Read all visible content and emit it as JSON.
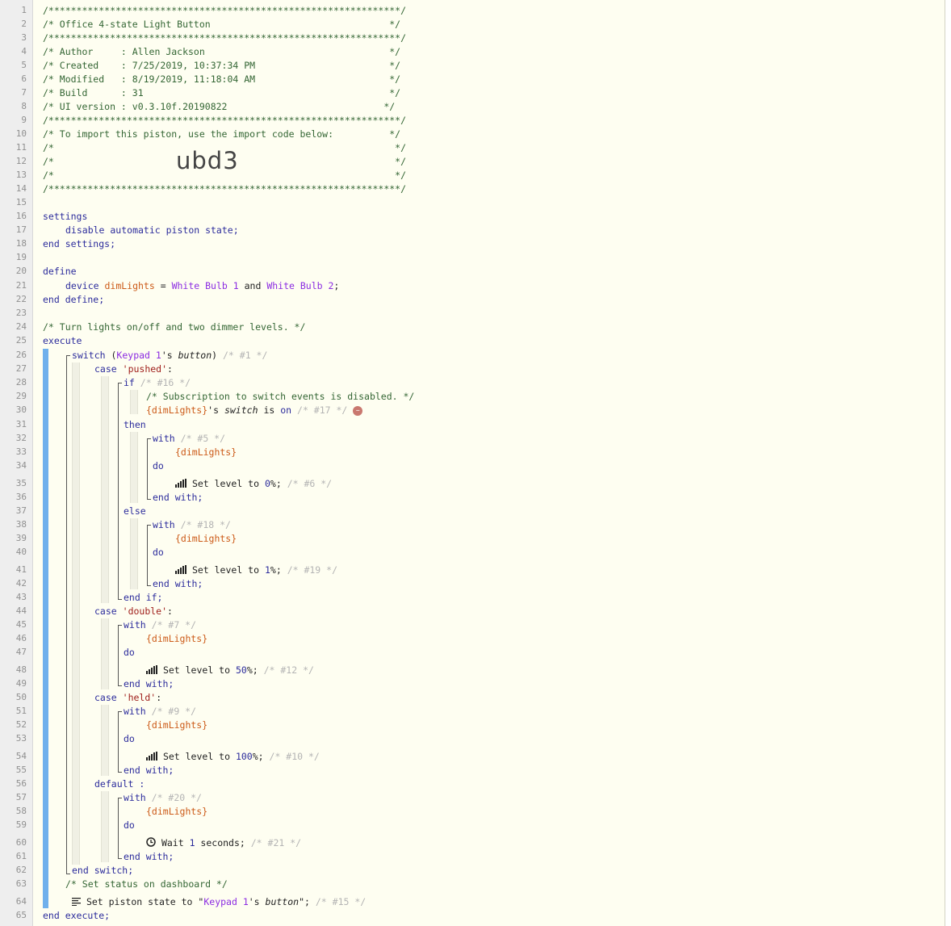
{
  "header": {
    "border": "/***************************************************************/",
    "title": "/* Office 4-state Light Button                                */",
    "author": "/* Author     : Allen Jackson                                 */",
    "created": "/* Created    : 7/25/2019, 10:37:34 PM                        */",
    "modified": "/* Modified   : 8/19/2019, 11:18:04 AM                        */",
    "build": "/* Build      : 31                                            */",
    "ui_version": "/* UI version : v0.3.10f.20190822                            */",
    "import_note": "/* To import this piston, use the import code below:          */",
    "blank": "/*                                                             */",
    "import_code": "ubd3"
  },
  "kw": {
    "settings": "settings",
    "end_settings": "end settings;",
    "define": "define",
    "end_define": "end define;",
    "execute": "execute",
    "end_execute": "end execute;",
    "switch": "switch",
    "case": "case",
    "if": "if",
    "then": "then",
    "else": "else",
    "with": "with",
    "do": "do",
    "end_with": "end with;",
    "end_if": "end if;",
    "default": "default :",
    "end_switch": "end switch;",
    "device": "device",
    "and": "and",
    "is": "is"
  },
  "settings_line": "disable automatic piston state;",
  "define_line": {
    "var": "dimLights",
    "eq": " = ",
    "dev1": "White Bulb 1",
    "dev2": "White Bulb 2",
    "end": ";"
  },
  "comments": {
    "turn": "/* Turn lights on/off and two dimmer levels. */",
    "subscription": "/* Subscription to switch events is disabled. */",
    "set_status": "/* Set status on dashboard */"
  },
  "switch_line": {
    "open": "(",
    "device": "Keypad 1",
    "apos": "'s ",
    "attr": "button",
    "close": ")",
    "id": " /* #1 */"
  },
  "cases": {
    "pushed": "'pushed'",
    "double": "'double'",
    "held": "'held'",
    "colon": ":"
  },
  "ids": {
    "n16": "/* #16 */",
    "n17": "/* #17 */",
    "n5": "/* #5 */",
    "n6": "/* #6 */",
    "n18": "/* #18 */",
    "n19": "/* #19 */",
    "n7": "/* #7 */",
    "n12": "/* #12 */",
    "n9": "/* #9 */",
    "n10": "/* #10 */",
    "n20": "/* #20 */",
    "n21": "/* #21 */",
    "n15": "/* #15 */"
  },
  "cond": {
    "var": "{dimLights}",
    "apos": "'s ",
    "attr": "switch",
    "value": "on"
  },
  "target": "{dimLights}",
  "actions": {
    "set_level": "Set level to ",
    "lvl0": "0",
    "lvl1": "1",
    "lvl50": "50",
    "lvl100": "100",
    "pct": "%;",
    "wait": "Wait ",
    "wait_n": "1",
    "wait_unit": " seconds;",
    "set_state": "Set piston state to ",
    "state_q1": "\"",
    "state_dev": "Keypad 1",
    "state_apos": "'s ",
    "state_attr": "button",
    "state_q2": "\";"
  },
  "line_numbers": [
    "1",
    "2",
    "3",
    "4",
    "5",
    "6",
    "7",
    "8",
    "9",
    "10",
    "11",
    "12",
    "13",
    "14",
    "15",
    "16",
    "17",
    "18",
    "19",
    "20",
    "21",
    "22",
    "23",
    "24",
    "25",
    "26",
    "27",
    "28",
    "29",
    "30",
    "31",
    "32",
    "33",
    "34",
    "35",
    "36",
    "37",
    "38",
    "39",
    "40",
    "41",
    "42",
    "43",
    "44",
    "45",
    "46",
    "47",
    "48",
    "49",
    "50",
    "51",
    "52",
    "53",
    "54",
    "55",
    "56",
    "57",
    "58",
    "59",
    "60",
    "61",
    "62",
    "63",
    "64",
    "65"
  ],
  "icons": {
    "level": "signal-bars-icon",
    "wait": "clock-icon",
    "state": "list-icon",
    "remove": "minus-icon",
    "remove_glyph": "–"
  },
  "colors": {
    "comment": "#346634",
    "keyword": "#2c2c9c",
    "device": "#8b2be2",
    "variable": "#cc5a18",
    "string": "#a0201c",
    "block_bar": "#6fb0ec"
  }
}
